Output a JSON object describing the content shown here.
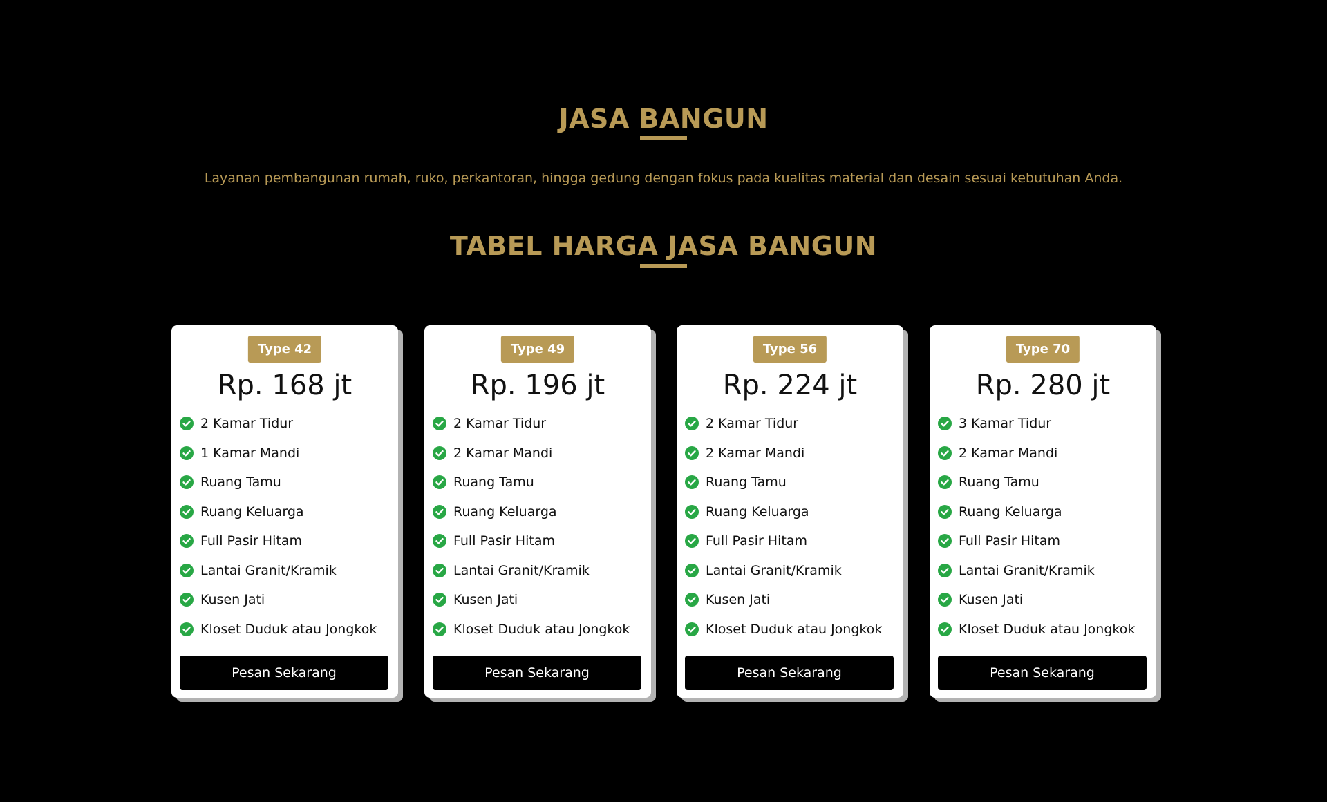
{
  "header": {
    "title": "JASA BANGUN",
    "subtitle": "Layanan pembangunan rumah, ruko, perkantoran, hingga gedung dengan fokus pada kualitas material dan desain sesuai kebutuhan Anda."
  },
  "pricing": {
    "title": "TABEL HARGA JASA BANGUN",
    "accent_color": "#b89a56",
    "check_color": "#28a745",
    "cards": [
      {
        "type": "Type 42",
        "price": "Rp. 168 jt",
        "features": [
          "2 Kamar Tidur",
          "1 Kamar Mandi",
          "Ruang Tamu",
          "Ruang Keluarga",
          "Full Pasir Hitam",
          "Lantai Granit/Kramik",
          "Kusen Jati",
          "Kloset Duduk atau Jongkok"
        ],
        "button": "Pesan Sekarang"
      },
      {
        "type": "Type 49",
        "price": "Rp. 196 jt",
        "features": [
          "2 Kamar Tidur",
          "2 Kamar Mandi",
          "Ruang Tamu",
          "Ruang Keluarga",
          "Full Pasir Hitam",
          "Lantai Granit/Kramik",
          "Kusen Jati",
          "Kloset Duduk atau Jongkok"
        ],
        "button": "Pesan Sekarang"
      },
      {
        "type": "Type 56",
        "price": "Rp. 224 jt",
        "features": [
          "2 Kamar Tidur",
          "2 Kamar Mandi",
          "Ruang Tamu",
          "Ruang Keluarga",
          "Full Pasir Hitam",
          "Lantai Granit/Kramik",
          "Kusen Jati",
          "Kloset Duduk atau Jongkok"
        ],
        "button": "Pesan Sekarang"
      },
      {
        "type": "Type 70",
        "price": "Rp. 280 jt",
        "features": [
          "3 Kamar Tidur",
          "2 Kamar Mandi",
          "Ruang Tamu",
          "Ruang Keluarga",
          "Full Pasir Hitam",
          "Lantai Granit/Kramik",
          "Kusen Jati",
          "Kloset Duduk atau Jongkok"
        ],
        "button": "Pesan Sekarang"
      }
    ]
  }
}
